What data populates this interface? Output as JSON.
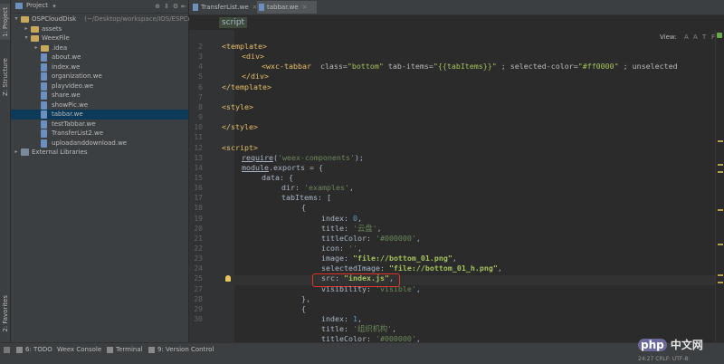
{
  "left_strip": {
    "project_tab": "1: Project",
    "structure_tab": "Z: Structure",
    "favorites_tab": "2: Favorites"
  },
  "project_panel": {
    "header_label": "Project",
    "tree": [
      {
        "label": "OSPCloudDisk",
        "suffix": "(~/Desktop/workspace/IOS/ESPComp",
        "type": "folder",
        "level": 0,
        "open": true
      },
      {
        "label": "assets",
        "type": "folder",
        "level": 1,
        "open": false
      },
      {
        "label": "WeexFile",
        "type": "folder",
        "level": 1,
        "open": true
      },
      {
        "label": ".idea",
        "type": "folder",
        "level": 2,
        "open": false
      },
      {
        "label": "about.we",
        "type": "file",
        "level": 2
      },
      {
        "label": "index.we",
        "type": "file",
        "level": 2
      },
      {
        "label": "organization.we",
        "type": "file",
        "level": 2
      },
      {
        "label": "playvideo.we",
        "type": "file",
        "level": 2
      },
      {
        "label": "share.we",
        "type": "file",
        "level": 2
      },
      {
        "label": "showPic.we",
        "type": "file",
        "level": 2
      },
      {
        "label": "tabbar.we",
        "type": "file",
        "level": 2,
        "selected": true
      },
      {
        "label": "testTabbar.we",
        "type": "file",
        "level": 2
      },
      {
        "label": "TransferList2.we",
        "type": "file",
        "level": 2
      },
      {
        "label": "uploadanddownload.we",
        "type": "file",
        "level": 2
      },
      {
        "label": "External Libraries",
        "type": "libs",
        "level": 0
      }
    ]
  },
  "editor": {
    "tabs": [
      {
        "label": "TransferList.we",
        "active": false
      },
      {
        "label": "tabbar.we",
        "active": true
      }
    ],
    "breadcrumb": "script",
    "view_label": "View:",
    "view_buttons": [
      "A",
      "A",
      "T",
      "F"
    ],
    "line_numbers": [
      "2",
      "3",
      "4",
      "5",
      "6",
      "7",
      "8",
      "9",
      "10",
      "11",
      "12",
      "13",
      "14",
      "15",
      "16",
      "17",
      "18",
      "19",
      "20",
      "21",
      "22",
      "23",
      "24",
      "25",
      "27",
      "28",
      "29",
      "30"
    ],
    "code_lines": [
      {
        "indent": 0,
        "tokens": [
          {
            "t": "<template>",
            "c": "tag"
          }
        ]
      },
      {
        "indent": 1,
        "tokens": [
          {
            "t": "<div>",
            "c": "tag"
          }
        ]
      },
      {
        "indent": 2,
        "tokens": [
          {
            "t": "<wxc-tabbar",
            "c": "tag"
          },
          {
            "t": "  class=",
            "c": "attr"
          },
          {
            "t": "\"bottom\"",
            "c": "aval"
          },
          {
            "t": " tab-items=",
            "c": "attr"
          },
          {
            "t": "\"{{tabItems}}\"",
            "c": "aval"
          },
          {
            "t": " ; selected-color=",
            "c": "attr"
          },
          {
            "t": "\"#ff0000\"",
            "c": "aval"
          },
          {
            "t": " ; unselected",
            "c": "attr"
          }
        ]
      },
      {
        "indent": 1,
        "tokens": [
          {
            "t": "</div>",
            "c": "tag"
          }
        ]
      },
      {
        "indent": 0,
        "tokens": [
          {
            "t": "</template>",
            "c": "tag"
          }
        ]
      },
      {
        "indent": 0,
        "tokens": []
      },
      {
        "indent": 0,
        "tokens": [
          {
            "t": "<style>",
            "c": "tag"
          }
        ]
      },
      {
        "indent": 0,
        "tokens": []
      },
      {
        "indent": 0,
        "tokens": [
          {
            "t": "</style>",
            "c": "tag"
          }
        ]
      },
      {
        "indent": 0,
        "tokens": []
      },
      {
        "indent": 0,
        "tokens": [
          {
            "t": "<script>",
            "c": "tag"
          }
        ]
      },
      {
        "indent": 1,
        "tokens": [
          {
            "t": "require",
            "c": "plain ul"
          },
          {
            "t": "(",
            "c": "plain"
          },
          {
            "t": "'weex-components'",
            "c": "str"
          },
          {
            "t": ");",
            "c": "plain"
          }
        ]
      },
      {
        "indent": 1,
        "tokens": [
          {
            "t": "module",
            "c": "plain ul"
          },
          {
            "t": ".",
            "c": "plain"
          },
          {
            "t": "exports",
            "c": "plain"
          },
          {
            "t": " = {",
            "c": "plain"
          }
        ]
      },
      {
        "indent": 2,
        "tokens": [
          {
            "t": "data",
            "c": "plain"
          },
          {
            "t": ": {",
            "c": "plain"
          }
        ]
      },
      {
        "indent": 3,
        "tokens": [
          {
            "t": "dir",
            "c": "plain"
          },
          {
            "t": ": ",
            "c": "plain"
          },
          {
            "t": "'examples'",
            "c": "str"
          },
          {
            "t": ",",
            "c": "plain"
          }
        ]
      },
      {
        "indent": 3,
        "tokens": [
          {
            "t": "tabItems",
            "c": "plain"
          },
          {
            "t": ": [",
            "c": "plain"
          }
        ]
      },
      {
        "indent": 4,
        "tokens": [
          {
            "t": "{",
            "c": "plain"
          }
        ]
      },
      {
        "indent": 5,
        "tokens": [
          {
            "t": "index",
            "c": "plain"
          },
          {
            "t": ": ",
            "c": "plain"
          },
          {
            "t": "0",
            "c": "num"
          },
          {
            "t": ",",
            "c": "plain"
          }
        ]
      },
      {
        "indent": 5,
        "tokens": [
          {
            "t": "title",
            "c": "plain"
          },
          {
            "t": ": ",
            "c": "plain"
          },
          {
            "t": "'云盘'",
            "c": "str"
          },
          {
            "t": ",",
            "c": "plain"
          }
        ]
      },
      {
        "indent": 5,
        "tokens": [
          {
            "t": "titleColor",
            "c": "plain"
          },
          {
            "t": ": ",
            "c": "plain"
          },
          {
            "t": "'#000000'",
            "c": "str"
          },
          {
            "t": ",",
            "c": "plain"
          }
        ]
      },
      {
        "indent": 5,
        "tokens": [
          {
            "t": "icon",
            "c": "plain"
          },
          {
            "t": ": ",
            "c": "plain"
          },
          {
            "t": "''",
            "c": "str"
          },
          {
            "t": ",",
            "c": "plain"
          }
        ]
      },
      {
        "indent": 5,
        "tokens": [
          {
            "t": "image",
            "c": "plain"
          },
          {
            "t": ": ",
            "c": "plain"
          },
          {
            "t": "\"file://bottom_01.png\"",
            "c": "strb"
          },
          {
            "t": ",",
            "c": "plain"
          }
        ]
      },
      {
        "indent": 5,
        "tokens": [
          {
            "t": "selectedImage",
            "c": "plain"
          },
          {
            "t": ": ",
            "c": "plain"
          },
          {
            "t": "\"file://bottom_01_h.png\"",
            "c": "strb"
          },
          {
            "t": ",",
            "c": "plain"
          }
        ]
      },
      {
        "indent": 5,
        "tokens": [
          {
            "t": "src",
            "c": "plain"
          },
          {
            "t": ": ",
            "c": "plain"
          },
          {
            "t": "\"index.js\"",
            "c": "strb"
          },
          {
            "t": ",",
            "c": "plain"
          }
        ]
      },
      {
        "indent": 5,
        "tokens": [
          {
            "t": "visibility",
            "c": "plain"
          },
          {
            "t": ": ",
            "c": "plain"
          },
          {
            "t": "'visible'",
            "c": "str"
          },
          {
            "t": ",",
            "c": "plain"
          }
        ]
      },
      {
        "indent": 4,
        "tokens": [
          {
            "t": "},",
            "c": "plain"
          }
        ]
      },
      {
        "indent": 4,
        "tokens": [
          {
            "t": "{",
            "c": "plain"
          }
        ]
      },
      {
        "indent": 5,
        "tokens": [
          {
            "t": "index",
            "c": "plain"
          },
          {
            "t": ": ",
            "c": "plain"
          },
          {
            "t": "1",
            "c": "num"
          },
          {
            "t": ",",
            "c": "plain"
          }
        ]
      },
      {
        "indent": 5,
        "tokens": [
          {
            "t": "title",
            "c": "plain"
          },
          {
            "t": ": ",
            "c": "plain"
          },
          {
            "t": "'组织机构'",
            "c": "str"
          },
          {
            "t": ",",
            "c": "plain"
          }
        ]
      },
      {
        "indent": 5,
        "tokens": [
          {
            "t": "titleColor",
            "c": "plain"
          },
          {
            "t": ": ",
            "c": "plain"
          },
          {
            "t": "'#000000'",
            "c": "str"
          },
          {
            "t": ",",
            "c": "plain"
          }
        ]
      }
    ]
  },
  "bottom_tools": [
    {
      "label": "6: TODO"
    },
    {
      "label": "Weex Console"
    },
    {
      "label": "Terminal"
    },
    {
      "label": "9: Version Control"
    }
  ],
  "status": "24:27  CRLF:  UTF-8:",
  "watermark": {
    "badge": "php",
    "text": "中文网"
  }
}
